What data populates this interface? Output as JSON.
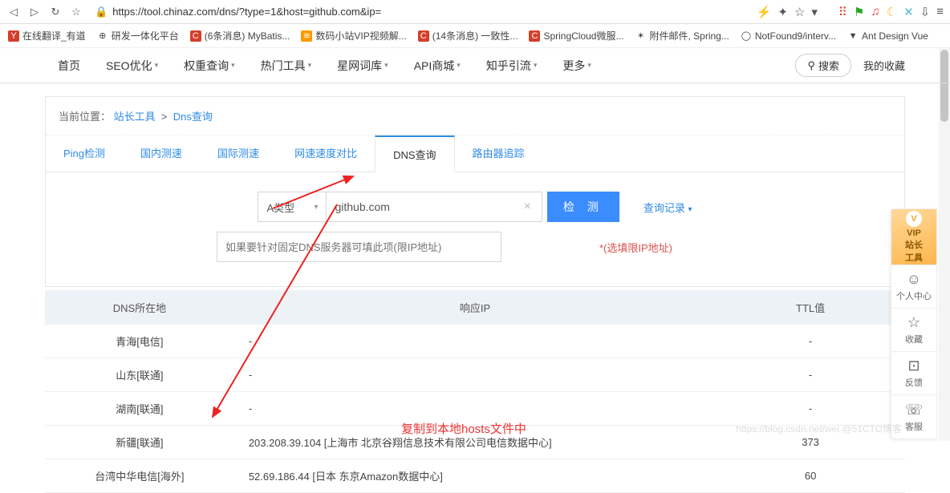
{
  "browser": {
    "url": "https://tool.chinaz.com/dns/?type=1&host=github.com&ip=",
    "right_icons": [
      "⚡",
      "✦",
      "☆",
      "▾",
      "⠿",
      "⚑",
      "♫",
      "☾",
      "✕",
      "⇩",
      "≡"
    ]
  },
  "bookmarks": [
    {
      "icon": "Y",
      "bg": "#d43f2a",
      "label": "在线翻译_有道"
    },
    {
      "icon": "⊕",
      "bg": "",
      "label": "研发一体化平台"
    },
    {
      "icon": "C",
      "bg": "#d43f2a",
      "label": "(6条消息) MyBatis..."
    },
    {
      "icon": "≋",
      "bg": "#ff9800",
      "label": "数码小站VIP视频解..."
    },
    {
      "icon": "C",
      "bg": "#d43f2a",
      "label": "(14条消息) 一致性..."
    },
    {
      "icon": "C",
      "bg": "#d43f2a",
      "label": "SpringCloud微服..."
    },
    {
      "icon": "✶",
      "bg": "",
      "label": "附件邮件, Spring..."
    },
    {
      "icon": "◯",
      "bg": "",
      "label": "NotFound9/interv..."
    },
    {
      "icon": "▼",
      "bg": "",
      "label": "Ant Design Vue"
    }
  ],
  "nav": {
    "items": [
      "首页",
      "SEO优化",
      "权重查询",
      "热门工具",
      "星网词库",
      "API商城",
      "知乎引流",
      "更多"
    ],
    "search": "搜索",
    "fav": "我的收藏"
  },
  "breadcrumb": {
    "prefix": "当前位置：",
    "a1": "站长工具",
    "sep": ">",
    "a2": "Dns查询"
  },
  "subtabs": [
    "Ping检测",
    "国内测速",
    "国际测速",
    "网速速度对比",
    "DNS查询",
    "路由器追踪"
  ],
  "subtab_active": 4,
  "form": {
    "type_label": "A类型",
    "host_value": "github.com",
    "detect": "检  测",
    "history": "查询记录",
    "ip_placeholder": "如果要针对固定DNS服务器可填此项(限IP地址)",
    "ip_hint": "*(选填限IP地址)"
  },
  "table": {
    "headers": [
      "DNS所在地",
      "响应IP",
      "TTL值"
    ],
    "rows": [
      {
        "loc": "青海[电信]",
        "ip": "-",
        "ttl": "-"
      },
      {
        "loc": "山东[联通]",
        "ip": "-",
        "ttl": "-"
      },
      {
        "loc": "湖南[联通]",
        "ip": "-",
        "ttl": "-"
      },
      {
        "loc": "新疆[联通]",
        "ip": "203.208.39.104 [上海市 北京谷翔信息技术有限公司电信数据中心]",
        "ttl": "373"
      },
      {
        "loc": "台湾中华电信[海外]",
        "ip": "52.69.186.44 [日本 东京Amazon数据中心]",
        "ttl": "60"
      }
    ]
  },
  "annotation": "复制到本地hosts文件中",
  "side": {
    "vip1": "VIP",
    "vip2": "站长",
    "vip3": "工具",
    "u": "个人中心",
    "s": "收藏",
    "f": "反馈",
    "k": "客服"
  },
  "watermark": "https://blog.csdn.net/wei   @51CTO博客"
}
